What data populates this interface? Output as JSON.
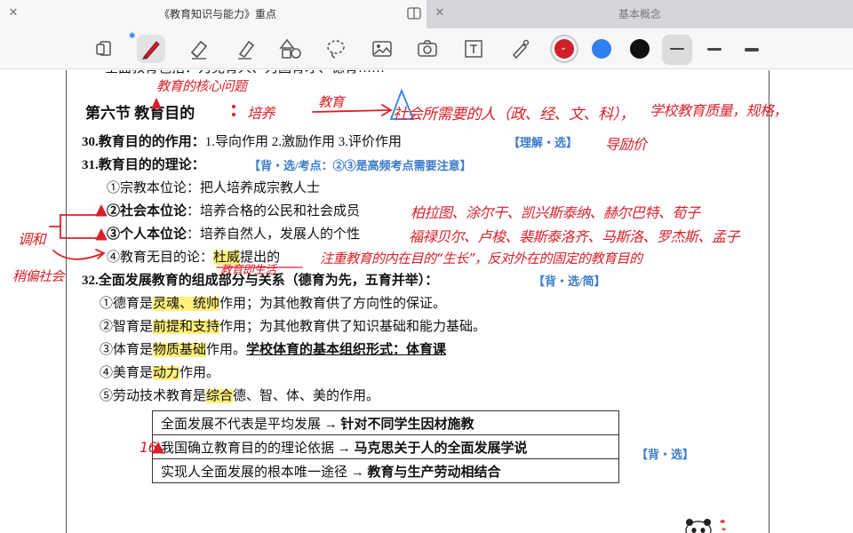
{
  "tabs": [
    {
      "title": "《教育知识与能力》重点",
      "active": true
    },
    {
      "title": "基本概念",
      "active": false
    }
  ],
  "toolbar": {
    "tools": [
      "page-view",
      "pen",
      "eraser",
      "highlighter",
      "shapes",
      "lasso",
      "image",
      "camera",
      "text",
      "laser"
    ],
    "selected_tool": "pen",
    "colors": [
      "#d01f2a",
      "#2f80f0",
      "#111111"
    ],
    "selected_color": "#d01f2a",
    "strokes": [
      "thin",
      "medium",
      "thick"
    ],
    "selected_stroke": "thin"
  },
  "doc": {
    "top_cut_text": "全面教育包括：为党育人、为国育才、德育……",
    "section_title": "第六节  教育目的",
    "item30": {
      "label": "30.教育目的的作用：",
      "text": "1.导向作用 2.激励作用 3.评价作用",
      "tag": "【理解・选】"
    },
    "item31": {
      "label": "31.教育目的的理论：",
      "tag": "【背・选/考点：②③是高频考点需要注意】"
    },
    "theories": [
      {
        "marker": "①",
        "name": "宗教本位论",
        "desc": "：把人培养成宗教人士"
      },
      {
        "marker": "②",
        "name": "社会本位论",
        "desc": "：培养合格的公民和社会成员"
      },
      {
        "marker": "③",
        "name": "个人本位论",
        "desc": "：培养自然人，发展人的个性"
      },
      {
        "marker": "④",
        "name": "教育无目的论",
        "desc_pre": "：",
        "person": "杜威",
        "desc_post": "提出的"
      }
    ],
    "item32": {
      "label": "32.全面发展教育的组成部分与关系（德育为先，五育并举）：",
      "tag": "【背・选/简】"
    },
    "parts": [
      {
        "pre": "①德育是",
        "key": "灵魂、统帅",
        "post": "作用；为其他教育供了方向性的保证。"
      },
      {
        "pre": "②智育是",
        "key": "前提和支持",
        "post": "作用；为其他教育供了知识基础和能力基础。"
      },
      {
        "pre": "③体育是",
        "key": "物质基础",
        "post": "作用。",
        "extra": "学校体育的基本组织形式：体育课"
      },
      {
        "pre": "④美育是",
        "key": "动力",
        "post": "作用。"
      },
      {
        "pre": "⑤劳动技术教育是",
        "key": "综合",
        "post": "德、智、体、美的作用。"
      }
    ],
    "table_rows": [
      {
        "left": "全面发展不代表是平均发展",
        "arrow": "→",
        "right": "针对不同学生因材施教"
      },
      {
        "left": "我国确立教育目的的理论依据",
        "arrow": "→",
        "right": "马克思关于人的全面发展学说"
      },
      {
        "left": "实现人全面发展的根本唯一途径",
        "arrow": "→",
        "right": "教育与生产劳动相结合"
      }
    ],
    "table_tag": "【背・选】"
  },
  "annotations": {
    "core_question": "教育的核心问题",
    "to_raise": "培养",
    "education": "教育",
    "society_needs": "社会所需要的人（政、经、文、科），",
    "school_quality": "学校教育质量，规格，",
    "guide_motivate": "导励价",
    "social_reps": "柏拉图、涂尔干、凯兴斯泰纳、赫尔巴特、荀子",
    "individual_reps": "福禄贝尔、卢梭、裴斯泰洛齐、马斯洛、罗杰斯、孟子",
    "reconcile": "调和",
    "lean_society": "稍偏社会",
    "dewey_note": "教育即生活",
    "purpose_note": "注重教育的内在目的“生长”，反对外在的固定的教育目的",
    "mark16": "16"
  }
}
